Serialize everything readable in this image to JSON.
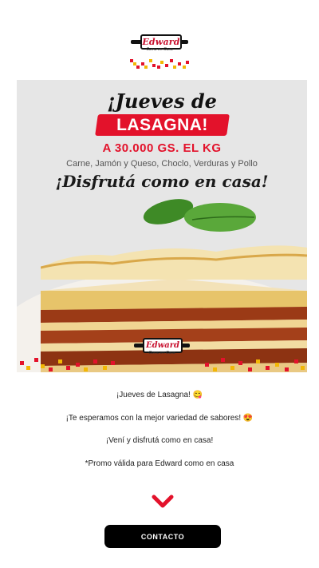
{
  "brand": {
    "name": "Edward",
    "tagline": "Como en Casa"
  },
  "hero": {
    "title": "¡Jueves de",
    "highlight": "LASAGNA!",
    "price": "A 30.000 GS. EL KG",
    "flavors": "Carne, Jamón y Queso, Choclo, Verduras y Pollo",
    "tagline": "¡Disfrutá como en casa!"
  },
  "post": {
    "line1": "¡Jueves de Lasagna! 😋",
    "line2": "¡Te esperamos con la mejor variedad de sabores! 😍",
    "line3": "¡Vení y disfrutá como en casa!",
    "line4": "*Promo válida para Edward como en casa"
  },
  "icons": {
    "scroll": "chevron-down-icon"
  },
  "cta": {
    "label": "CONTACTO"
  },
  "colors": {
    "accent": "#e3122b",
    "yellow": "#f2b705",
    "cta_bg": "#000000"
  }
}
